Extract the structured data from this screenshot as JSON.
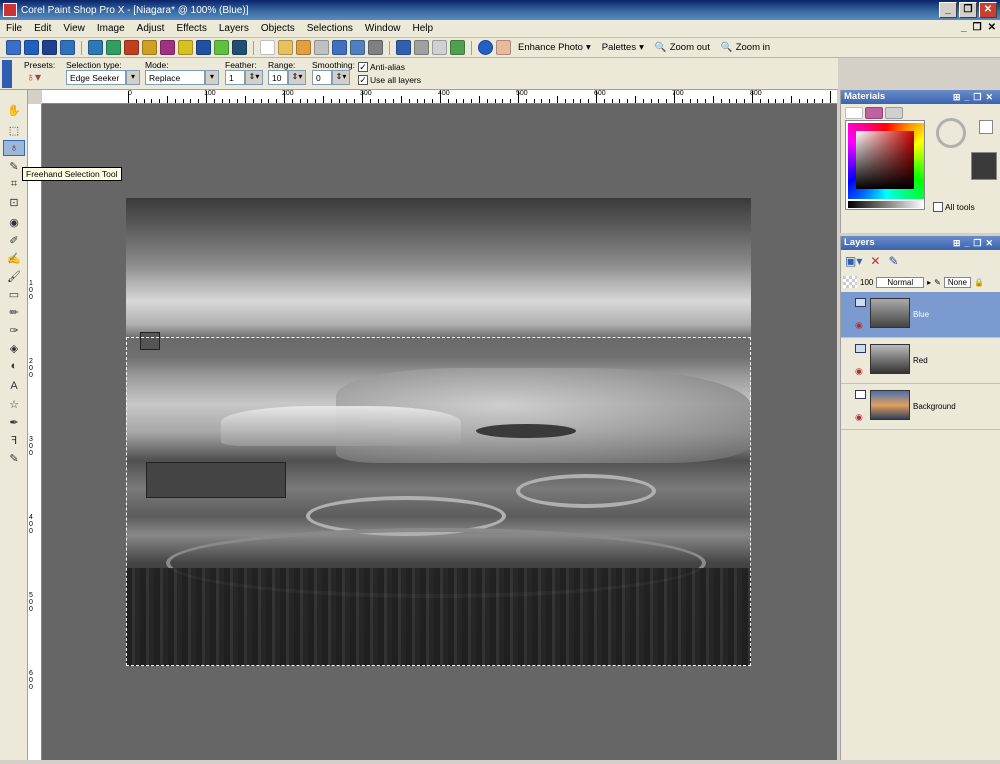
{
  "window": {
    "title": "Corel Paint Shop Pro X - [Niagara* @ 100% (Blue)]",
    "min": "_",
    "max": "❐",
    "close": "✕"
  },
  "menu": {
    "items": [
      "File",
      "Edit",
      "View",
      "Image",
      "Adjust",
      "Effects",
      "Layers",
      "Objects",
      "Selections",
      "Window",
      "Help"
    ],
    "doc_min": "_",
    "doc_restore": "❐",
    "doc_close": "✕"
  },
  "toolbar": {
    "enhance_photo": "Enhance Photo",
    "palettes": "Palettes",
    "zoom_out": "Zoom out",
    "zoom_in": "Zoom in"
  },
  "options": {
    "presets_label": "Presets:",
    "selection_type_label": "Selection type:",
    "selection_type": "Edge Seeker",
    "mode_label": "Mode:",
    "mode": "Replace",
    "feather_label": "Feather:",
    "feather": "1",
    "range_label": "Range:",
    "range": "10",
    "smoothing_label": "Smoothing:",
    "smoothing": "0",
    "anti_alias": "Anti-alias",
    "use_all_layers": "Use all layers"
  },
  "tooltip": "Freehand Selection Tool",
  "ruler": {
    "h": [
      "0",
      "100",
      "200",
      "300",
      "400",
      "500",
      "600",
      "700",
      "800"
    ],
    "v": [
      "100",
      "200",
      "300",
      "400",
      "500",
      "600"
    ]
  },
  "materials": {
    "title": "Materials",
    "all_tools": "All tools"
  },
  "layers": {
    "title": "Layers",
    "opacity": "100",
    "blend": "Normal",
    "mask": "None",
    "items": [
      {
        "name": "Blue"
      },
      {
        "name": "Red"
      },
      {
        "name": "Background"
      }
    ]
  },
  "colors": {
    "accent": "#3a64b0",
    "canvas": "#666666"
  }
}
